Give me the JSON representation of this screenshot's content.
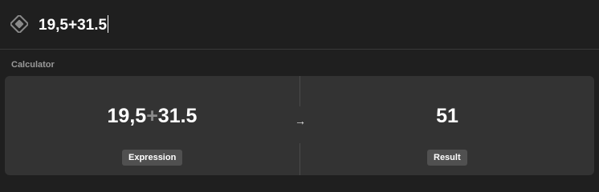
{
  "search": {
    "query": "19,5+31.5",
    "icon": "raycast-logo-icon"
  },
  "section": {
    "title": "Calculator"
  },
  "calculator": {
    "expression_left": "19,5",
    "operator": "+",
    "expression_right": "31.5",
    "arrow": "→",
    "result": "51",
    "expression_label": "Expression",
    "result_label": "Result"
  },
  "colors": {
    "background": "#1f1f1f",
    "card": "#333333",
    "chip": "#505050",
    "operator": "#8a8a8a",
    "section_title": "#9a9a9a"
  }
}
